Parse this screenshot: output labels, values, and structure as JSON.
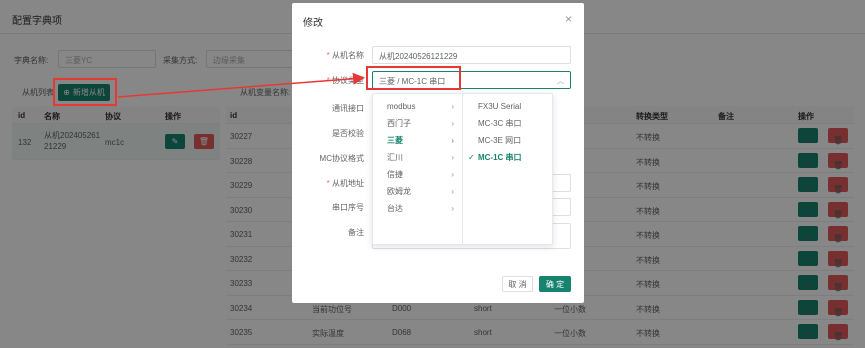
{
  "page": {
    "title": "配置字典项",
    "filter": {
      "dict_label": "字典名称:",
      "dict_value": "三菱YC",
      "collect_label": "采集方式:",
      "collect_value": "边缘采集"
    },
    "slave_list_label": "从机列表",
    "add_slave_label": "新增从机",
    "slave_var_label": "从机变量名称:"
  },
  "left_table": {
    "headers": [
      "id",
      "名称",
      "协议",
      "操作"
    ],
    "rows": [
      {
        "id": "132",
        "name": "从机20240526121229",
        "protocol": "mc1c"
      }
    ]
  },
  "right_table": {
    "headers": [
      "id",
      "",
      "",
      "",
      "数",
      "转换类型",
      "备注",
      "操作"
    ],
    "rows": [
      {
        "id": "30227",
        "name": "",
        "addr": "",
        "type": "",
        "decimal": "",
        "convert": "不转换"
      },
      {
        "id": "30228",
        "name": "",
        "addr": "",
        "type": "",
        "decimal": "",
        "convert": "不转换"
      },
      {
        "id": "30229",
        "name": "",
        "addr": "",
        "type": "",
        "decimal": "",
        "convert": "不转换"
      },
      {
        "id": "30230",
        "name": "",
        "addr": "",
        "type": "",
        "decimal": "",
        "convert": "不转换"
      },
      {
        "id": "30231",
        "name": "",
        "addr": "",
        "type": "",
        "decimal": "",
        "convert": "不转换"
      },
      {
        "id": "30232",
        "name": "",
        "addr": "",
        "type": "",
        "decimal": "",
        "convert": "不转换"
      },
      {
        "id": "30233",
        "name": "",
        "addr": "",
        "type": "",
        "decimal": "",
        "convert": "不转换"
      },
      {
        "id": "30234",
        "name": "当前功位号",
        "addr": "D000",
        "type": "short",
        "decimal": "一位小数",
        "convert": "不转换"
      },
      {
        "id": "30235",
        "name": "实际温度",
        "addr": "D068",
        "type": "short",
        "decimal": "一位小数",
        "convert": "不转换"
      }
    ]
  },
  "modal": {
    "title": "修改",
    "close": "×",
    "fields": {
      "slave_name_label": "从机名称",
      "slave_name_value": "从机20240526121229",
      "protocol_type_label": "协议类型",
      "protocol_type_value": "三菱 / MC-1C 串口",
      "port_label": "通讯接口",
      "check_label": "是否校验",
      "mc_format_label": "MC协议格式",
      "slave_addr_label": "从机地址",
      "serial_label": "串口序号",
      "remark_label": "备注"
    },
    "cancel_label": "取 消",
    "ok_label": "确 定"
  },
  "cascader": {
    "level1": [
      "modbus",
      "西门子",
      "三菱",
      "汇川",
      "信捷",
      "欧姆龙",
      "台达"
    ],
    "level1_active": "三菱",
    "level2": [
      "FX3U Serial",
      "MC-3C 串口",
      "MC-3E 网口",
      "MC-1C 串口"
    ],
    "level2_active": "MC-1C 串口"
  },
  "colors": {
    "primary": "#17836f",
    "danger": "#e05a5a",
    "highlight": "#e53935"
  }
}
